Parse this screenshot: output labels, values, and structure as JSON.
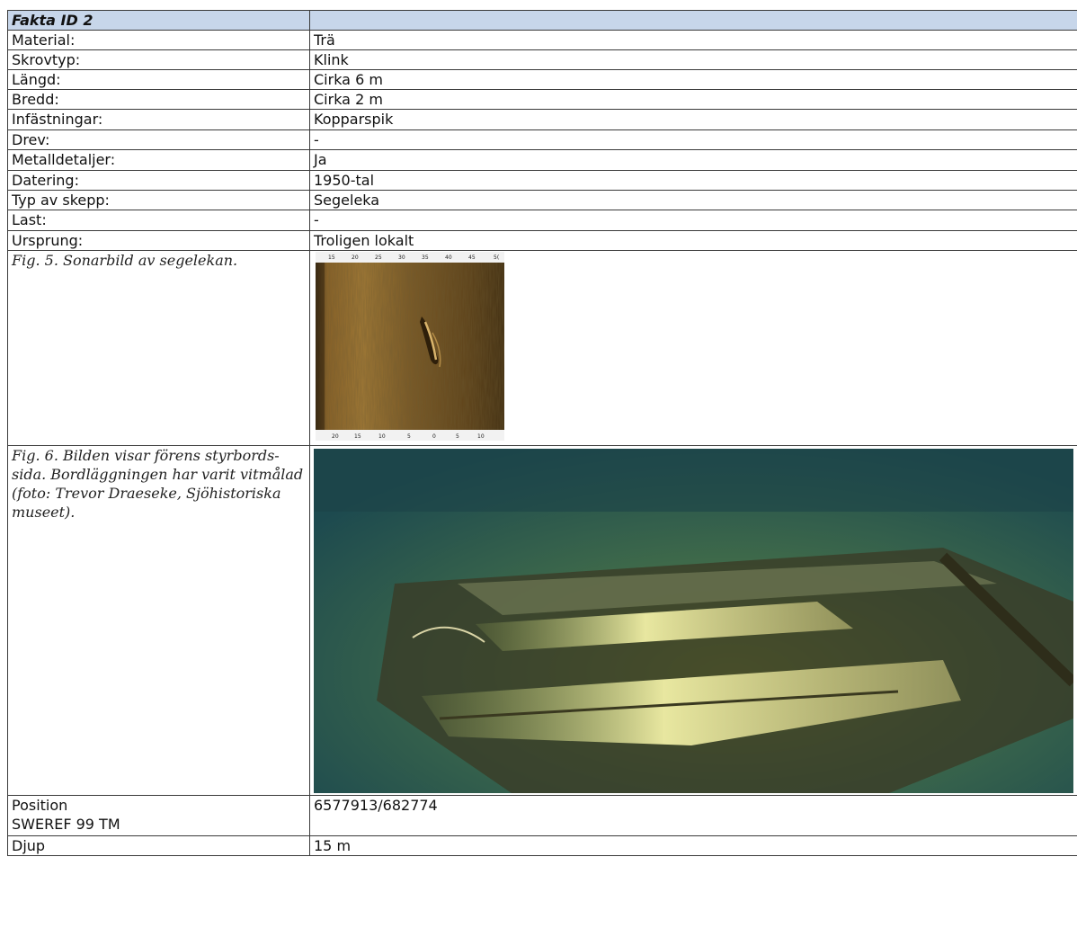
{
  "header": {
    "title": "Fakta ID 2"
  },
  "rows": [
    {
      "label": "Material:",
      "value": "Trä"
    },
    {
      "label": "Skrovtyp:",
      "value": "Klink"
    },
    {
      "label": "Längd:",
      "value": "Cirka 6 m"
    },
    {
      "label": "Bredd:",
      "value": "Cirka 2 m"
    },
    {
      "label": "Infästningar:",
      "value": "Kopparspik"
    },
    {
      "label": "Drev:",
      "value": "-"
    },
    {
      "label": "Metalldetaljer:",
      "value": "Ja"
    },
    {
      "label": "Datering:",
      "value": "1950-tal"
    },
    {
      "label": "Typ av skepp:",
      "value": "Segeleka"
    },
    {
      "label": "Last:",
      "value": "-"
    },
    {
      "label": "Ursprung:",
      "value": "Troligen lokalt"
    }
  ],
  "figures": [
    {
      "caption": "Fig. 5. Sonarbild av segelekan.",
      "image": "sonar-image",
      "top_ticks": [
        "15",
        "20",
        "25",
        "30",
        "35",
        "40",
        "45",
        "5("
      ],
      "bottom_ticks": [
        "20",
        "15",
        "10",
        "5",
        "0",
        "5",
        "10"
      ]
    },
    {
      "caption": "Fig. 6. Bilden visar förens styrbords-sida. Bordläggningen har varit vitmålad (foto: Trevor Draeseke, Sjöhistoriska museet).",
      "image": "underwater-photo"
    }
  ],
  "position": {
    "label_line1": "Position",
    "label_line2": "SWEREF 99 TM",
    "value": "6577913/682774"
  },
  "depth": {
    "label": "Djup",
    "value": "15 m"
  },
  "colors": {
    "header_bg": "#c7d6ea",
    "border": "#3a3a3a"
  }
}
